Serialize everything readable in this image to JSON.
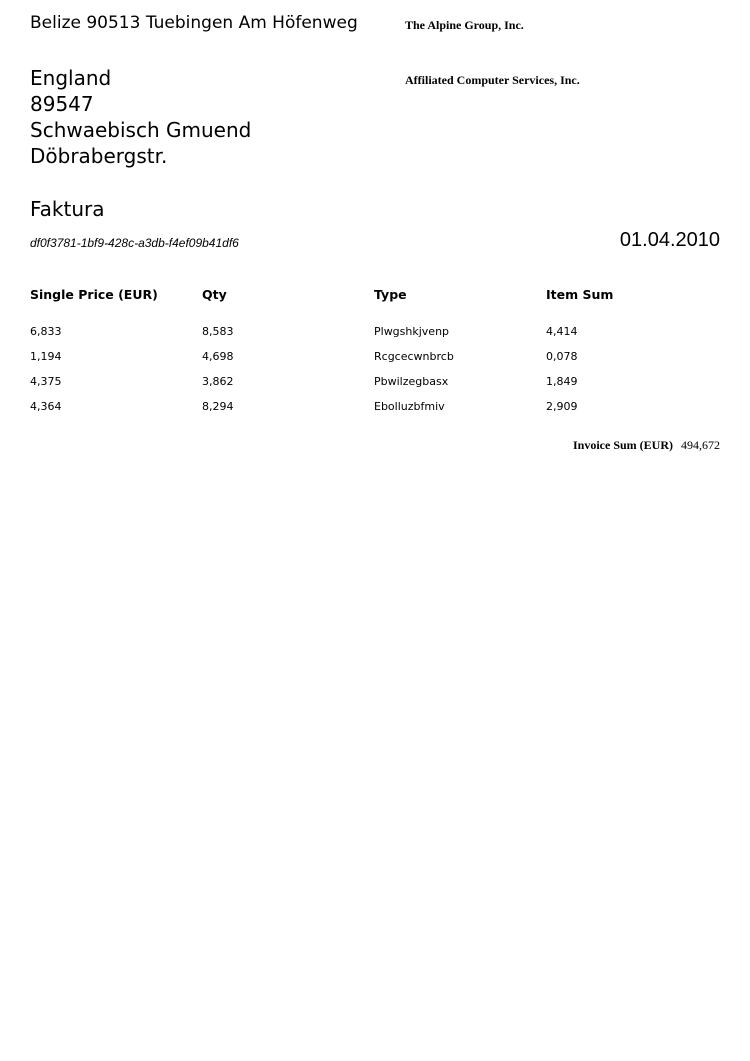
{
  "sender": {
    "line": "Belize 90513 Tuebingen Am Höfenweg"
  },
  "companies": {
    "first": "The Alpine Group, Inc.",
    "second": "Affiliated Computer Services, Inc."
  },
  "recipient": {
    "country": "England",
    "postcode": "89547",
    "city": "Schwaebisch Gmuend",
    "street": "Döbrabergstr."
  },
  "document": {
    "title": "Faktura",
    "id": "df0f3781-1bf9-428c-a3db-f4ef09b41df6",
    "date": "01.04.2010"
  },
  "table": {
    "headers": [
      "Single Price (EUR)",
      "Qty",
      "Type",
      "Item Sum"
    ],
    "rows": [
      [
        "6,833",
        "8,583",
        "Plwgshkjvenp",
        "4,414"
      ],
      [
        "1,194",
        "4,698",
        "Rcgcecwnbrcb",
        "0,078"
      ],
      [
        "4,375",
        "3,862",
        "Pbwilzegbasx",
        "1,849"
      ],
      [
        "4,364",
        "8,294",
        "Ebolluzbfmiv",
        "2,909"
      ]
    ]
  },
  "summary": {
    "label": "Invoice Sum (EUR)",
    "value": "494,672"
  }
}
